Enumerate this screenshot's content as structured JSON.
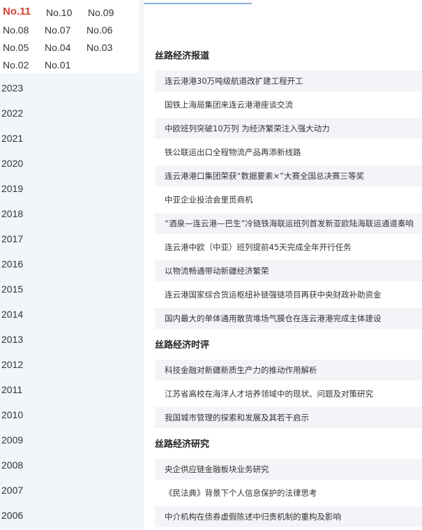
{
  "issues": [
    "No.11",
    "No.10",
    "No.09",
    "No.08",
    "No.07",
    "No.06",
    "No.05",
    "No.04",
    "No.03",
    "No.02",
    "No.01"
  ],
  "active_issue": "No.11",
  "years": [
    "2023",
    "2022",
    "2021",
    "2020",
    "2019",
    "2018",
    "2017",
    "2016",
    "2015",
    "2014",
    "2013",
    "2012",
    "2011",
    "2010",
    "2009",
    "2008",
    "2007",
    "2006"
  ],
  "sections": [
    {
      "title": "丝路经济报道",
      "articles": [
        "连云港港30万吨级航道改扩建工程开工",
        "国铁上海局集团来连云港港座谈交流",
        "中欧班列突破10万列 为经济繁荣注入强大动力",
        "铁公联运出口全程物流产品再添新线路",
        "连云港港口集团荣获“数据要素×”大赛全国总决赛三等奖",
        "中亚企业投洽会里觅商机",
        "“酒泉—连云港—巴生”冷链铁海联运班列首发新亚欧陆海联运通道奏响",
        "连云港中欧（中亚）班列提前45天完成全年开行任务",
        "以物流畅通带动新疆经济繁荣",
        "连云港国家综合货运枢纽补链强链项目再获中央财政补助资金",
        "国内最大的单体通用散货堆场气膜仓在连云港港完成主体建设"
      ]
    },
    {
      "title": "丝路经济时评",
      "articles": [
        "科技金融对新疆新质生产力的推动作用解析",
        "江苏省高校在海洋人才培养领域中的现状、问题及对策研究",
        "我国城市管理的探索和发展及其若干启示"
      ]
    },
    {
      "title": "丝路经济研究",
      "articles": [
        "央企供应链金融板块业务研究",
        "《民法典》背景下个人信息保护的法律思考",
        "中介机构在债券虚假陈述中归责机制的重构及影响"
      ]
    }
  ]
}
